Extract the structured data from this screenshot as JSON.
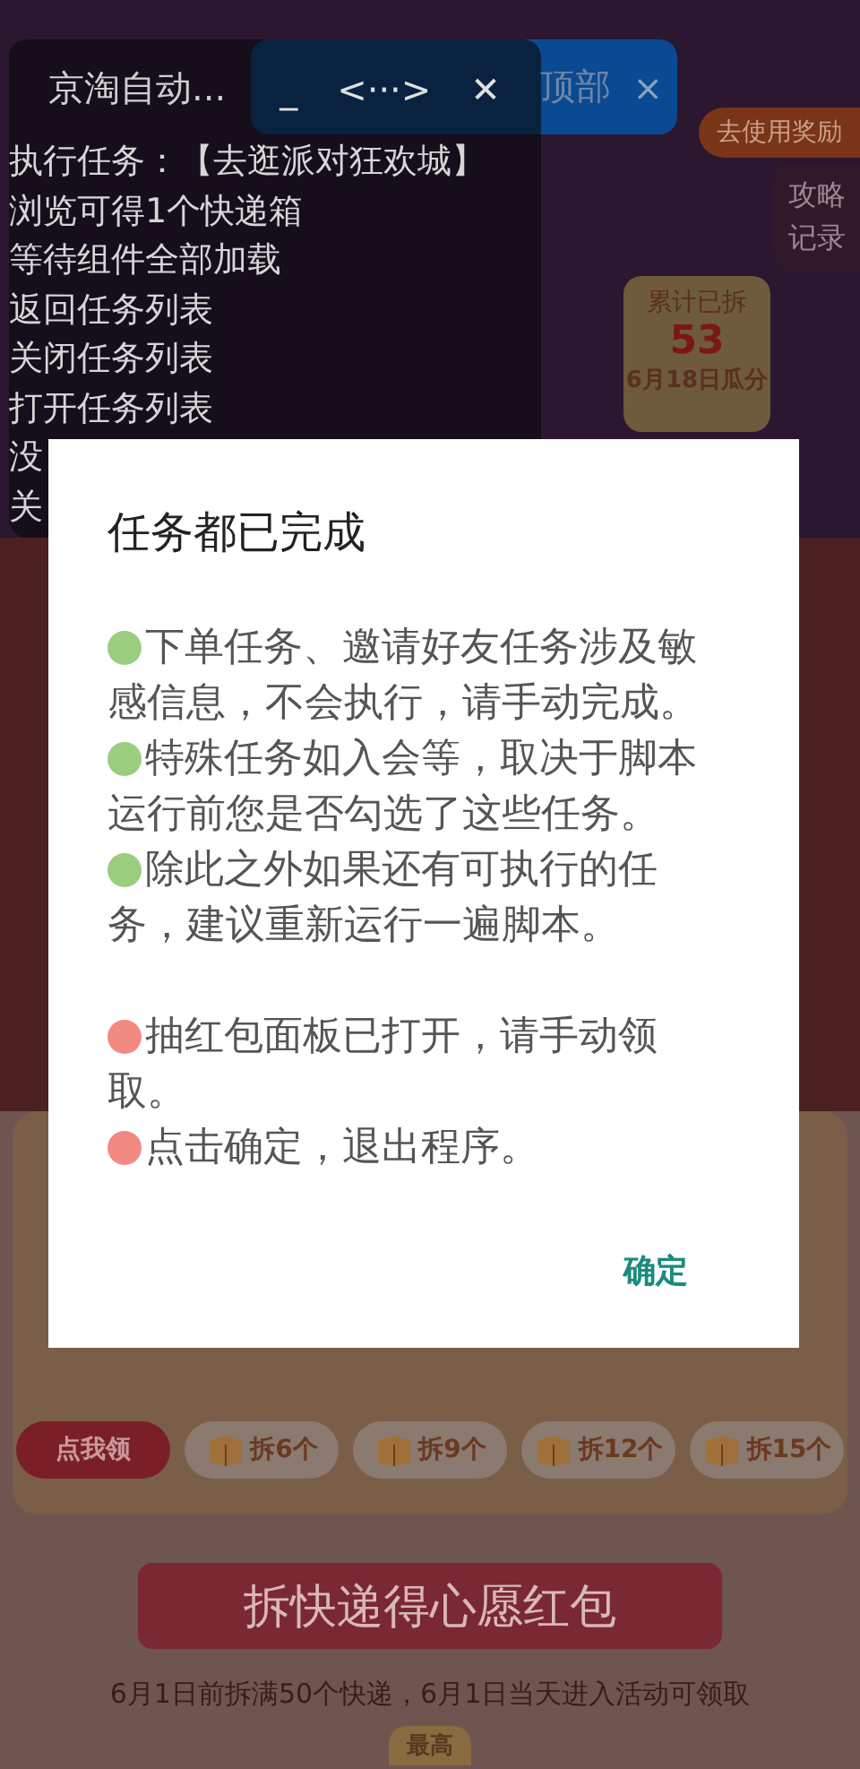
{
  "page": {
    "reward_pill": "去使用奖励",
    "side_links": [
      "攻略",
      "记录"
    ],
    "counter": {
      "label": "累计已拆",
      "value": "53",
      "note": "6月18日瓜分"
    },
    "claim_buttons": [
      {
        "label": "点我领",
        "kind": "claim"
      },
      {
        "label": "拆6个",
        "kind": "box"
      },
      {
        "label": "拆9个",
        "kind": "box"
      },
      {
        "label": "拆12个",
        "kind": "box"
      },
      {
        "label": "拆15个",
        "kind": "box"
      }
    ],
    "banner": "拆快递得心愿红包",
    "notice": "6月1日前拆满50个快递，6月1日当天进入活动可领取",
    "badge": "最高"
  },
  "toast": {
    "text": "顶部",
    "close": "×"
  },
  "log_panel": {
    "title": "京淘自动...",
    "controls": [
      "_",
      "<···>",
      "✕"
    ],
    "lines": [
      "执行任务：【去逛派对狂欢城】",
      "浏览可得1个快递箱",
      "等待组件全部加载",
      "返回任务列表",
      "关闭任务列表",
      "打开任务列表",
      "没",
      "关"
    ]
  },
  "dialog": {
    "title": "任务都已完成",
    "sections": [
      {
        "items": [
          {
            "color": "#9acd7e",
            "text": "下单任务、邀请好友任务涉及敏感信息，不会执行，请手动完成。"
          },
          {
            "color": "#9acd7e",
            "text": "特殊任务如入会等，取决于脚本运行前您是否勾选了这些任务。"
          },
          {
            "color": "#9acd7e",
            "text": "除此之外如果还有可执行的任务，建议重新运行一遍脚本。"
          }
        ]
      },
      {
        "items": [
          {
            "color": "#f28a82",
            "text": "抽红包面板已打开，请手动领取。"
          },
          {
            "color": "#f28a82",
            "text": "点击确定，退出程序。"
          }
        ]
      }
    ],
    "button": "确定"
  }
}
